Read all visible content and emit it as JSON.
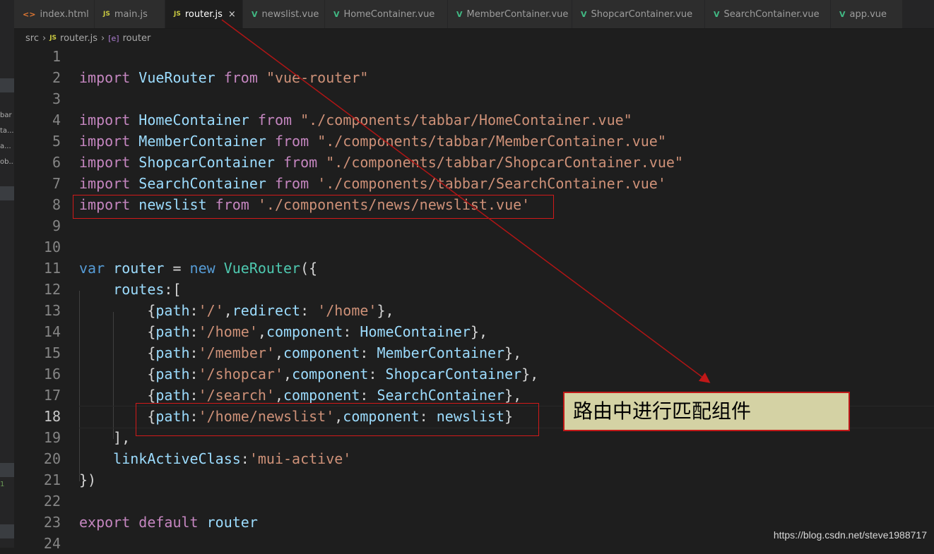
{
  "tabs": [
    {
      "icon": "html",
      "icon_text": "<>",
      "label": "index.html",
      "active": false
    },
    {
      "icon": "js",
      "icon_text": "JS",
      "label": "main.js",
      "active": false
    },
    {
      "icon": "js",
      "icon_text": "JS",
      "label": "router.js",
      "active": true
    },
    {
      "icon": "vue",
      "icon_text": "V",
      "label": "newslist.vue",
      "active": false
    },
    {
      "icon": "vue",
      "icon_text": "V",
      "label": "HomeContainer.vue",
      "active": false
    },
    {
      "icon": "vue",
      "icon_text": "V",
      "label": "MemberContainer.vue",
      "active": false
    },
    {
      "icon": "vue",
      "icon_text": "V",
      "label": "ShopcarContainer.vue",
      "active": false
    },
    {
      "icon": "vue",
      "icon_text": "V",
      "label": "SearchContainer.vue",
      "active": false
    },
    {
      "icon": "vue",
      "icon_text": "V",
      "label": "app.vue",
      "active": false
    }
  ],
  "tab_close_glyph": "×",
  "breadcrumb": {
    "folder": "src",
    "file_icon": "JS",
    "file": "router.js",
    "symbol_icon": "[e]",
    "symbol": "router",
    "separator": "›"
  },
  "sidebar_stubs": [
    "bar",
    "ta...",
    "a...",
    "ob...",
    "1"
  ],
  "editor": {
    "current_line": 18,
    "lines": [
      {
        "n": "1",
        "indent": 0,
        "tokens": []
      },
      {
        "n": "2",
        "indent": 0,
        "tokens": [
          [
            "kw",
            "import"
          ],
          [
            "txt",
            " "
          ],
          [
            "id",
            "VueRouter"
          ],
          [
            "txt",
            " "
          ],
          [
            "kw",
            "from"
          ],
          [
            "txt",
            " "
          ],
          [
            "str",
            "\"vue-router\""
          ]
        ]
      },
      {
        "n": "3",
        "indent": 0,
        "tokens": []
      },
      {
        "n": "4",
        "indent": 0,
        "tokens": [
          [
            "kw",
            "import"
          ],
          [
            "txt",
            " "
          ],
          [
            "id",
            "HomeContainer"
          ],
          [
            "txt",
            " "
          ],
          [
            "kw",
            "from"
          ],
          [
            "txt",
            " "
          ],
          [
            "str",
            "\"./components/tabbar/HomeContainer.vue\""
          ]
        ]
      },
      {
        "n": "5",
        "indent": 0,
        "tokens": [
          [
            "kw",
            "import"
          ],
          [
            "txt",
            " "
          ],
          [
            "id",
            "MemberContainer"
          ],
          [
            "txt",
            " "
          ],
          [
            "kw",
            "from"
          ],
          [
            "txt",
            " "
          ],
          [
            "str",
            "\"./components/tabbar/MemberContainer.vue\""
          ]
        ]
      },
      {
        "n": "6",
        "indent": 0,
        "tokens": [
          [
            "kw",
            "import"
          ],
          [
            "txt",
            " "
          ],
          [
            "id",
            "ShopcarContainer"
          ],
          [
            "txt",
            " "
          ],
          [
            "kw",
            "from"
          ],
          [
            "txt",
            " "
          ],
          [
            "str",
            "\"./components/tabbar/ShopcarContainer.vue\""
          ]
        ]
      },
      {
        "n": "7",
        "indent": 0,
        "tokens": [
          [
            "kw",
            "import"
          ],
          [
            "txt",
            " "
          ],
          [
            "id",
            "SearchContainer"
          ],
          [
            "txt",
            " "
          ],
          [
            "kw",
            "from"
          ],
          [
            "txt",
            " "
          ],
          [
            "str",
            "'./components/tabbar/SearchContainer.vue'"
          ]
        ]
      },
      {
        "n": "8",
        "indent": 0,
        "tokens": [
          [
            "kw",
            "import"
          ],
          [
            "txt",
            " "
          ],
          [
            "id",
            "newslist"
          ],
          [
            "txt",
            " "
          ],
          [
            "kw",
            "from"
          ],
          [
            "txt",
            " "
          ],
          [
            "str",
            "'./components/news/newslist.vue'"
          ]
        ]
      },
      {
        "n": "9",
        "indent": 0,
        "tokens": []
      },
      {
        "n": "10",
        "indent": 0,
        "tokens": []
      },
      {
        "n": "11",
        "indent": 0,
        "tokens": [
          [
            "kb",
            "var"
          ],
          [
            "txt",
            " "
          ],
          [
            "id",
            "router"
          ],
          [
            "txt",
            " = "
          ],
          [
            "kb",
            "new"
          ],
          [
            "txt",
            " "
          ],
          [
            "cls",
            "VueRouter"
          ],
          [
            "txt",
            "({"
          ]
        ]
      },
      {
        "n": "12",
        "indent": 1,
        "tokens": [
          [
            "txt",
            "    "
          ],
          [
            "id",
            "routes"
          ],
          [
            "txt",
            ":["
          ]
        ]
      },
      {
        "n": "13",
        "indent": 2,
        "tokens": [
          [
            "txt",
            "        {"
          ],
          [
            "id",
            "path"
          ],
          [
            "txt",
            ":"
          ],
          [
            "str",
            "'/'"
          ],
          [
            "txt",
            ","
          ],
          [
            "id",
            "redirect"
          ],
          [
            "txt",
            ": "
          ],
          [
            "str",
            "'/home'"
          ],
          [
            "txt",
            "},"
          ]
        ]
      },
      {
        "n": "14",
        "indent": 2,
        "tokens": [
          [
            "txt",
            "        {"
          ],
          [
            "id",
            "path"
          ],
          [
            "txt",
            ":"
          ],
          [
            "str",
            "'/home'"
          ],
          [
            "txt",
            ","
          ],
          [
            "id",
            "component"
          ],
          [
            "txt",
            ": "
          ],
          [
            "id",
            "HomeContainer"
          ],
          [
            "txt",
            "},"
          ]
        ]
      },
      {
        "n": "15",
        "indent": 2,
        "tokens": [
          [
            "txt",
            "        {"
          ],
          [
            "id",
            "path"
          ],
          [
            "txt",
            ":"
          ],
          [
            "str",
            "'/member'"
          ],
          [
            "txt",
            ","
          ],
          [
            "id",
            "component"
          ],
          [
            "txt",
            ": "
          ],
          [
            "id",
            "MemberContainer"
          ],
          [
            "txt",
            "},"
          ]
        ]
      },
      {
        "n": "16",
        "indent": 2,
        "tokens": [
          [
            "txt",
            "        {"
          ],
          [
            "id",
            "path"
          ],
          [
            "txt",
            ":"
          ],
          [
            "str",
            "'/shopcar'"
          ],
          [
            "txt",
            ","
          ],
          [
            "id",
            "component"
          ],
          [
            "txt",
            ": "
          ],
          [
            "id",
            "ShopcarContainer"
          ],
          [
            "txt",
            "},"
          ]
        ]
      },
      {
        "n": "17",
        "indent": 2,
        "tokens": [
          [
            "txt",
            "        {"
          ],
          [
            "id",
            "path"
          ],
          [
            "txt",
            ":"
          ],
          [
            "str",
            "'/search'"
          ],
          [
            "txt",
            ","
          ],
          [
            "id",
            "component"
          ],
          [
            "txt",
            ": "
          ],
          [
            "id",
            "SearchContainer"
          ],
          [
            "txt",
            "},"
          ]
        ]
      },
      {
        "n": "18",
        "indent": 2,
        "tokens": [
          [
            "txt",
            "        {"
          ],
          [
            "id",
            "path"
          ],
          [
            "txt",
            ":"
          ],
          [
            "str",
            "'/home/newslist'"
          ],
          [
            "txt",
            ","
          ],
          [
            "id",
            "component"
          ],
          [
            "txt",
            ": "
          ],
          [
            "id",
            "newslist"
          ],
          [
            "txt",
            "}"
          ]
        ]
      },
      {
        "n": "19",
        "indent": 1,
        "tokens": [
          [
            "txt",
            "    ],"
          ]
        ]
      },
      {
        "n": "20",
        "indent": 1,
        "tokens": [
          [
            "txt",
            "    "
          ],
          [
            "id",
            "linkActiveClass"
          ],
          [
            "txt",
            ":"
          ],
          [
            "str",
            "'mui-active'"
          ]
        ]
      },
      {
        "n": "21",
        "indent": 0,
        "tokens": [
          [
            "txt",
            "})"
          ]
        ]
      },
      {
        "n": "22",
        "indent": 0,
        "tokens": []
      },
      {
        "n": "23",
        "indent": 0,
        "tokens": [
          [
            "kw",
            "export"
          ],
          [
            "txt",
            " "
          ],
          [
            "kw",
            "default"
          ],
          [
            "txt",
            " "
          ],
          [
            "id",
            "router"
          ]
        ]
      },
      {
        "n": "24",
        "indent": 0,
        "tokens": []
      }
    ]
  },
  "annotation": {
    "callout_text": "路由中进行匹配组件",
    "highlight_color": "#d11a1a"
  },
  "watermark": "https://blog.csdn.net/steve1988717",
  "colors": {
    "editor_bg": "#1e1e1e",
    "keyword": "#c586c0",
    "storage": "#569cd6",
    "identifier": "#9cdcfe",
    "class": "#4ec9b0",
    "string": "#ce9178",
    "callout_bg": "#d4d2a4"
  }
}
